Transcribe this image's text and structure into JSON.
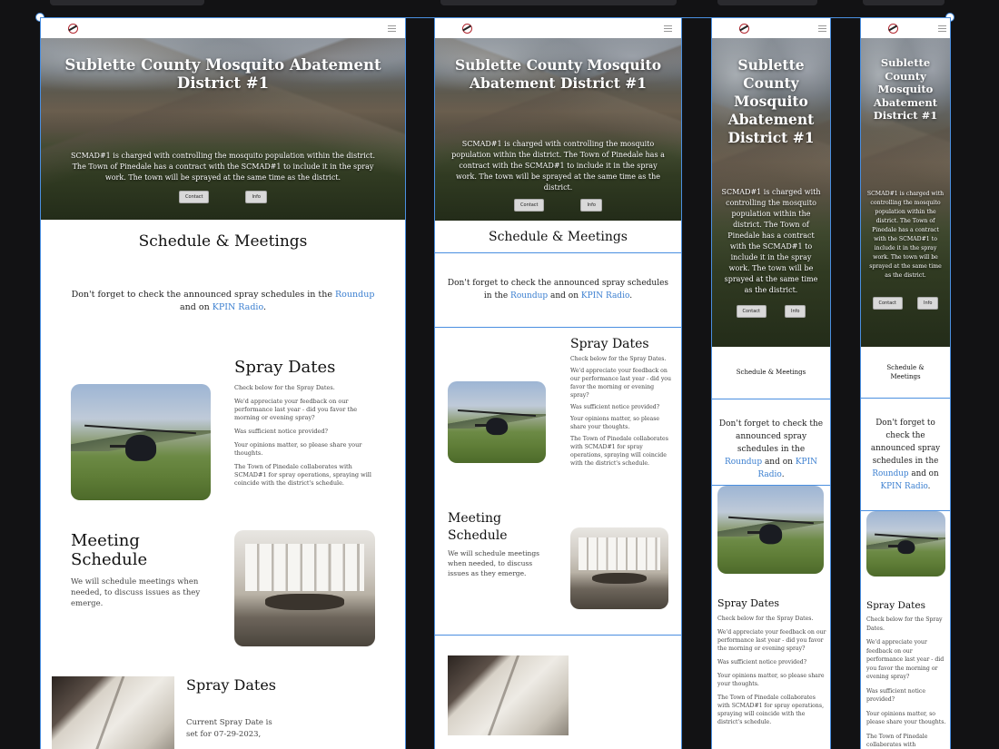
{
  "site": {
    "title": "Sublette County Mosquito Abatement District #1",
    "hero_text": "SCMAD#1 is charged with controlling the mosquito population within the district. The Town of Pinedale has a contract with the SCMAD#1 to include it in the spray work. The town will be sprayed at the same time as the district.",
    "contact_button": "Contact",
    "info_button": "Info"
  },
  "schedule": {
    "heading": "Schedule & Meetings",
    "notice_before": "Don't forget to check the announced spray schedules in the ",
    "roundup_link": "Roundup",
    "notice_middle": " and on ",
    "kpin_link": "KPIN Radio",
    "notice_after": "."
  },
  "spray": {
    "heading": "Spray Dates",
    "p1": "Check below for the Spray Dates.",
    "p2": "We'd appreciate your feedback on our performance last year - did you favor the morning or evening spray?",
    "p3": "Was sufficient notice provided?",
    "p4": "Your opinions matter, so please share your thoughts.",
    "p5": "The Town of Pinedale collaborates with SCMAD#1 for spray operations, spraying will coincide with the district's schedule."
  },
  "meeting": {
    "heading": "Meeting Schedule",
    "text": "We will schedule meetings when needed, to discuss issues as they emerge."
  },
  "spray_dates": {
    "heading": "Spray Dates",
    "current": "Current Spray Date is set for 07-29-2023,"
  },
  "colors": {
    "selection_outline": "#4a8fe0",
    "link": "#3b7fd0",
    "canvas_background": "#121214"
  }
}
